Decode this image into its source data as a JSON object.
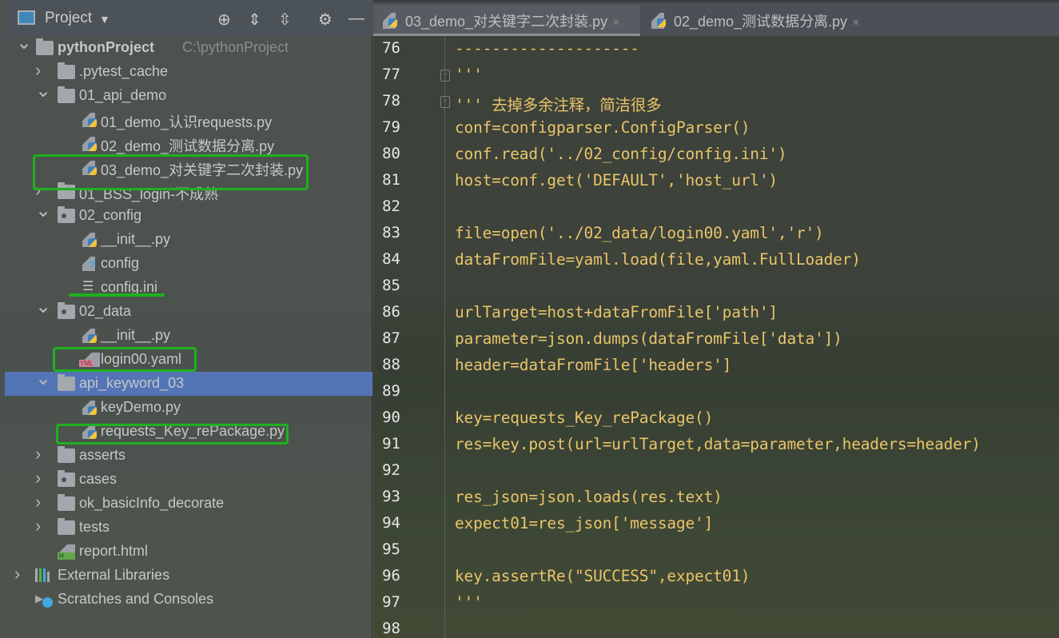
{
  "sidebar": {
    "title": "Project",
    "icons": [
      "locate-icon",
      "expand-all-icon",
      "collapse-all-icon",
      "gear-icon",
      "minimize-icon"
    ],
    "root": {
      "name": "pythonProject",
      "path": "C:\\pythonProject"
    },
    "items": [
      {
        "label": ".pytest_cache",
        "type": "folder",
        "expanded": false
      },
      {
        "label": "01_api_demo",
        "type": "folder",
        "expanded": true
      },
      {
        "label": "01_demo_认识requests.py",
        "type": "python"
      },
      {
        "label": "02_demo_测试数据分离.py",
        "type": "python"
      },
      {
        "label": "03_demo_对关键字二次封装.py",
        "type": "python"
      },
      {
        "label": "01_BSS_login-不成熟",
        "type": "folder",
        "expanded": false
      },
      {
        "label": "02_config",
        "type": "package",
        "expanded": true
      },
      {
        "label": "__init__.py",
        "type": "python"
      },
      {
        "label": "config",
        "type": "unknown"
      },
      {
        "label": "config.ini",
        "type": "ini"
      },
      {
        "label": "02_data",
        "type": "package",
        "expanded": true
      },
      {
        "label": "__init__.py",
        "type": "python"
      },
      {
        "label": "login00.yaml",
        "type": "yaml",
        "badge": "YML"
      },
      {
        "label": "api_keyword_03",
        "type": "folder",
        "expanded": true,
        "selected": true
      },
      {
        "label": "keyDemo.py",
        "type": "python"
      },
      {
        "label": "requests_Key_rePackage.py",
        "type": "python"
      },
      {
        "label": "asserts",
        "type": "folder",
        "expanded": false
      },
      {
        "label": "cases",
        "type": "package",
        "expanded": false
      },
      {
        "label": "ok_basicInfo_decorate",
        "type": "folder",
        "expanded": false
      },
      {
        "label": "tests",
        "type": "folder",
        "expanded": false
      },
      {
        "label": "report.html",
        "type": "html",
        "badge": "H"
      }
    ],
    "external_libraries": "External Libraries",
    "scratches": "Scratches and Consoles"
  },
  "tabs": [
    {
      "label": "03_demo_对关键字二次封装.py",
      "active": true,
      "close": "×"
    },
    {
      "label": "02_demo_测试数据分离.py",
      "active": false,
      "close": "×"
    }
  ],
  "editor": {
    "lines": [
      {
        "n": "76",
        "code": "--------------------"
      },
      {
        "n": "77",
        "code": "'''"
      },
      {
        "n": "78",
        "code": "''' 去掉多余注释，简洁很多"
      },
      {
        "n": "79",
        "code": "conf=configparser.ConfigParser()"
      },
      {
        "n": "80",
        "code": "conf.read('../02_config/config.ini')"
      },
      {
        "n": "81",
        "code": "host=conf.get('DEFAULT','host_url')"
      },
      {
        "n": "82",
        "code": ""
      },
      {
        "n": "83",
        "code": "file=open('../02_data/login00.yaml','r')"
      },
      {
        "n": "84",
        "code": "dataFromFile=yaml.load(file,yaml.FullLoader)"
      },
      {
        "n": "85",
        "code": ""
      },
      {
        "n": "86",
        "code": "urlTarget=host+dataFromFile['path']"
      },
      {
        "n": "87",
        "code": "parameter=json.dumps(dataFromFile['data'])"
      },
      {
        "n": "88",
        "code": "header=dataFromFile['headers']"
      },
      {
        "n": "89",
        "code": ""
      },
      {
        "n": "90",
        "code": "key=requests_Key_rePackage()"
      },
      {
        "n": "91",
        "code": "res=key.post(url=urlTarget,data=parameter,headers=header)"
      },
      {
        "n": "92",
        "code": ""
      },
      {
        "n": "93",
        "code": "res_json=json.loads(res.text)"
      },
      {
        "n": "94",
        "code": "expect01=res_json['message']"
      },
      {
        "n": "95",
        "code": ""
      },
      {
        "n": "96",
        "code": "key.assertRe(\"SUCCESS\",expect01)"
      },
      {
        "n": "97",
        "code": "'''"
      },
      {
        "n": "98",
        "code": ""
      }
    ]
  },
  "colors": {
    "selection": "#5374b5",
    "highlight_box": "#1fb01f",
    "code": "#e9c46a"
  }
}
